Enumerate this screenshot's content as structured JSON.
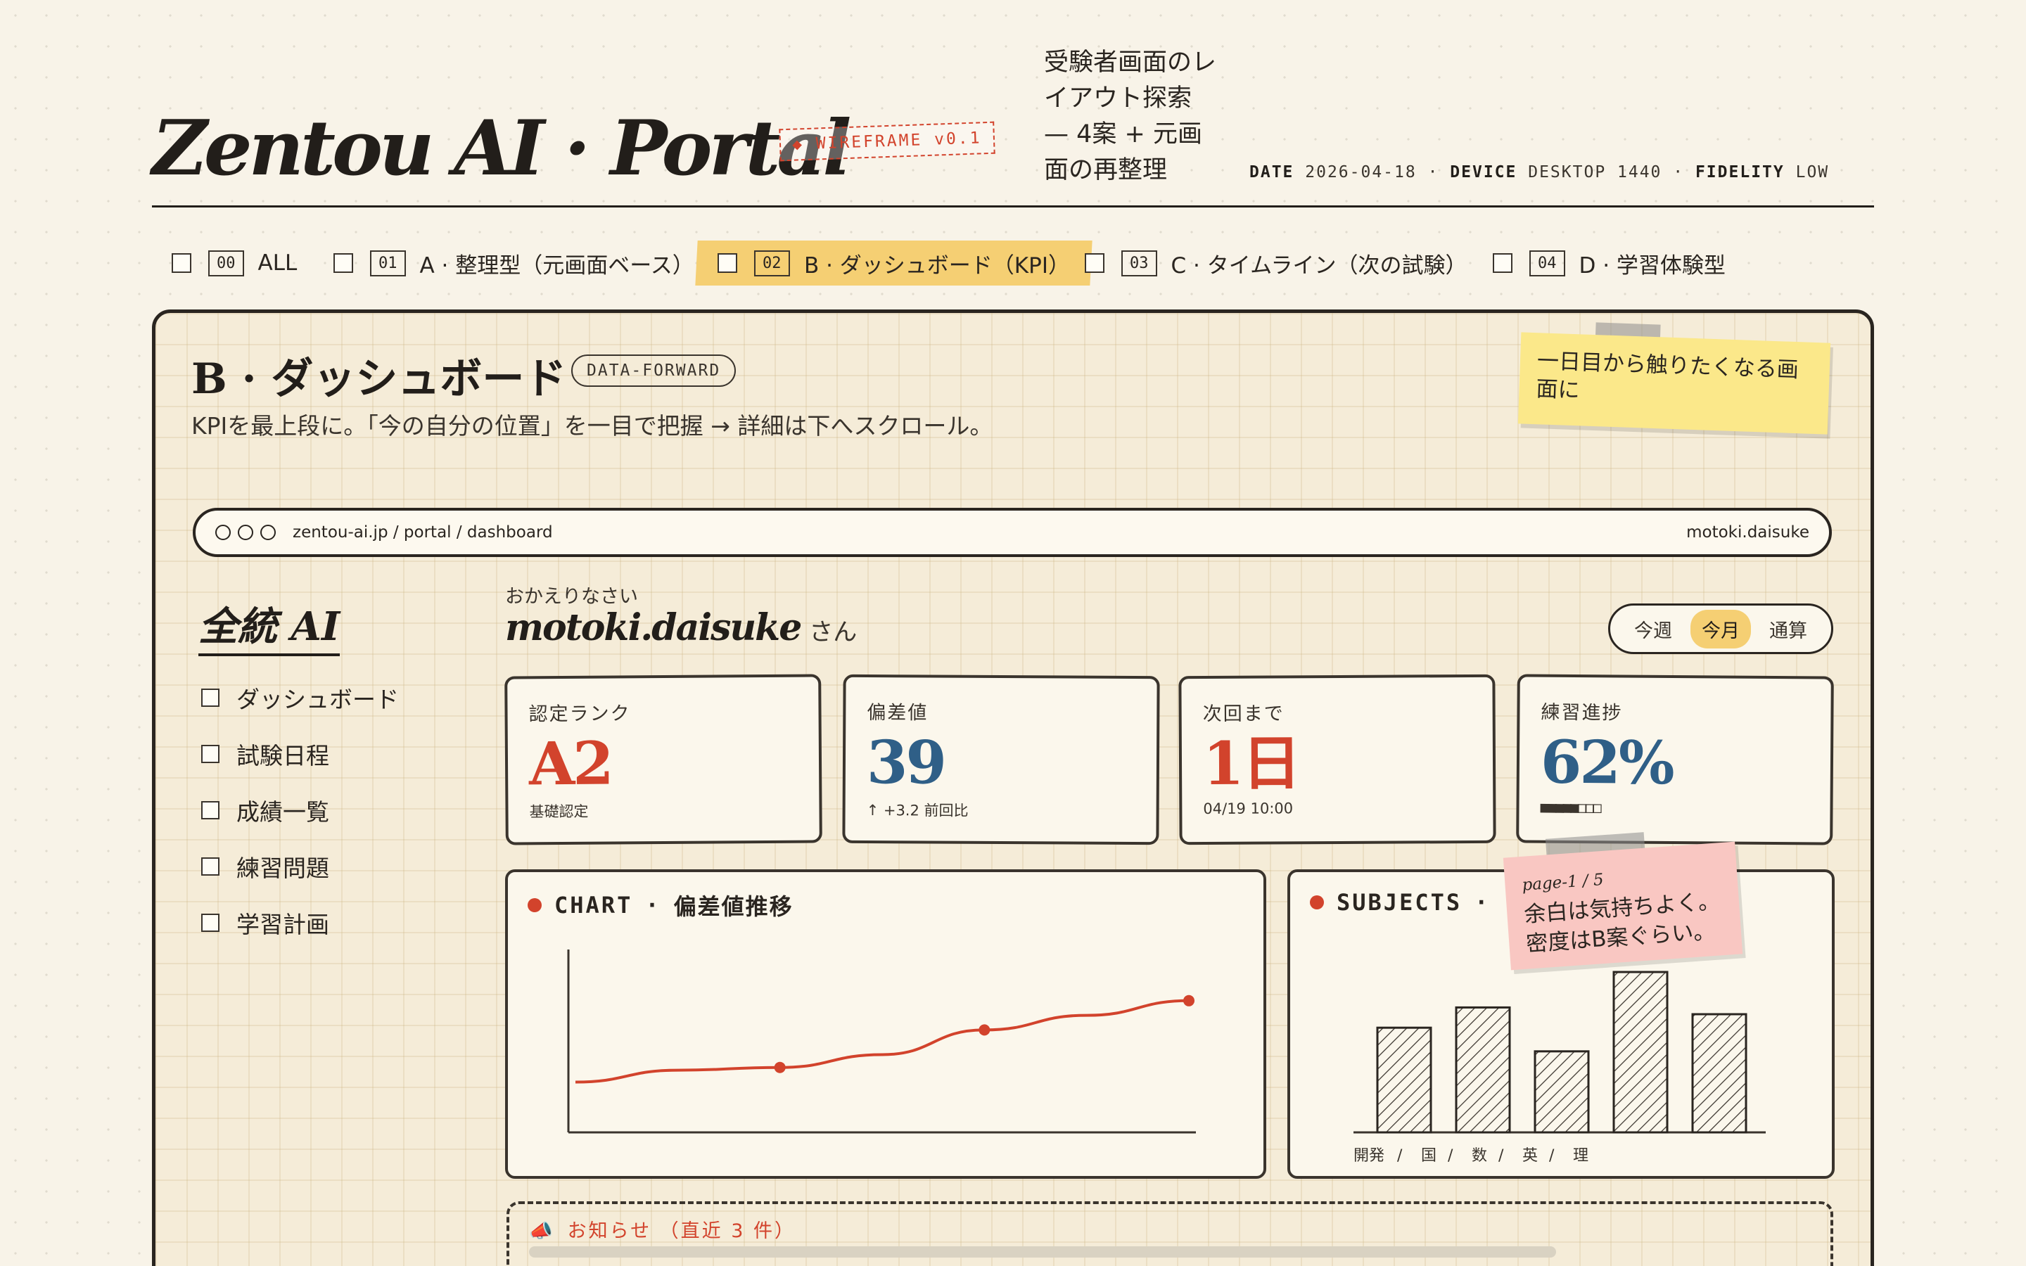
{
  "header": {
    "brand": "Zentou AI · Portal",
    "badge": "◆ WIREFRAME v0.1",
    "subtitle": "受験者画面のレイアウト探索 — 4案 + 元画面の再整理",
    "meta": {
      "date_label": "DATE",
      "date": "2026-04-18",
      "device_label": "DEVICE",
      "device": "DESKTOP 1440",
      "fidelity_label": "FIDELITY",
      "fidelity": "LOW"
    }
  },
  "tabs": [
    {
      "num": "00",
      "label": "ALL",
      "active": false
    },
    {
      "num": "01",
      "label": "A · 整理型（元画面ベース）",
      "active": false
    },
    {
      "num": "02",
      "label": "B · ダッシュボード（KPI）",
      "active": true
    },
    {
      "num": "03",
      "label": "C · タイムライン（次の試験）",
      "active": false
    },
    {
      "num": "04",
      "label": "D · 学習体験型",
      "active": false
    }
  ],
  "frame": {
    "title": "B · ダッシュボード",
    "tag": "DATA-FORWARD",
    "description": "KPIを最上段に。「今の自分の位置」を一目で把握 → 詳細は下へスクロール。",
    "sticky_yellow": "一日目から触りたくなる画面に",
    "sticky_pink": {
      "page": "page-1 / 5",
      "text": "余白は気持ちよく。密度はB案ぐらい。"
    }
  },
  "browser": {
    "url": "zentou-ai.jp / portal / dashboard",
    "user": "motoki.daisuke"
  },
  "sidebar": {
    "logo": "全統 AI",
    "items": [
      "ダッシュボード",
      "試験日程",
      "成績一覧",
      "練習問題",
      "学習計画"
    ]
  },
  "greeting": {
    "small": "おかえりなさい",
    "name": "motoki.daisuke",
    "honorific": "さん"
  },
  "period": {
    "options": [
      "今週",
      "今月",
      "通算"
    ],
    "selected": "今月"
  },
  "kpis": [
    {
      "label": "認定ランク",
      "value": "A2",
      "sub": "基礎認定",
      "color": "#d2432c"
    },
    {
      "label": "偏差値",
      "value": "39",
      "sub": "↑ +3.2 前回比",
      "color": "#2f5f87"
    },
    {
      "label": "次回まで",
      "value": "1日",
      "sub": "04/19 10:00",
      "color": "#d2432c"
    },
    {
      "label": "練習進捗",
      "value": "62%",
      "sub": "■■■■■□□□",
      "color": "#2f5f87",
      "progress": 0.62
    }
  ],
  "chart_panel": {
    "label": "CHART",
    "title": "偏差値推移"
  },
  "subjects_panel": {
    "label": "SUBJECTS",
    "title": ""
  },
  "chart_data": [
    {
      "type": "line",
      "title": "偏差値推移",
      "x": [
        1,
        2,
        3,
        4,
        5,
        6,
        7
      ],
      "values": [
        35.5,
        36.8,
        37.1,
        38.5,
        41.2,
        42.8,
        44.4
      ],
      "markers": [
        2,
        4,
        6
      ],
      "ylim": [
        30,
        50
      ],
      "grid": false,
      "color": "#d2432c"
    },
    {
      "type": "bar",
      "title": "SUBJECTS",
      "categories": [
        "開発",
        "国",
        "数",
        "英",
        "理"
      ],
      "values": [
        62,
        74,
        48,
        95,
        70
      ],
      "ylim": [
        0,
        100
      ],
      "grid": false,
      "pattern": "hatch"
    }
  ],
  "notice": {
    "title": "お知らせ （直近 3 件）",
    "icon": "megaphone-icon"
  },
  "colors": {
    "accent_red": "#d2432c",
    "accent_blue": "#2f5f87",
    "highlight_yellow": "#f5cf73",
    "paper": "#f8f3e8"
  }
}
